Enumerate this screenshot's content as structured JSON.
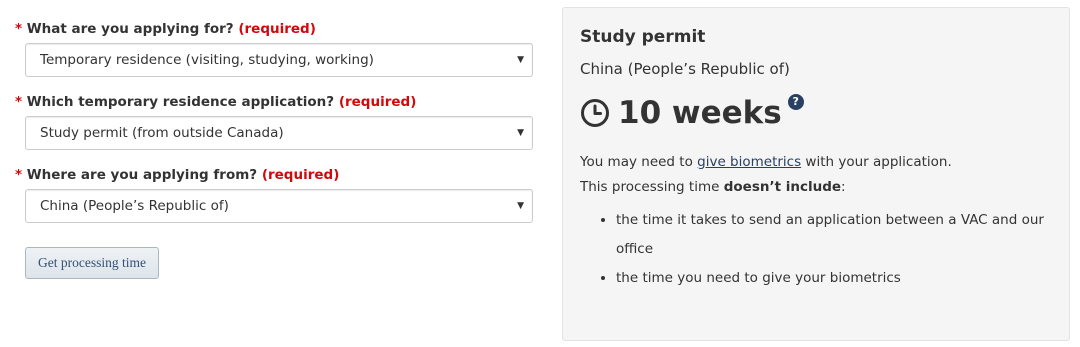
{
  "form": {
    "required_marker": "*",
    "required_text": "(required)",
    "fields": [
      {
        "label": "What are you applying for?",
        "value": "Temporary residence (visiting, studying, working)"
      },
      {
        "label": "Which temporary residence application?",
        "value": "Study permit (from outside Canada)"
      },
      {
        "label": "Where are you applying from?",
        "value": "China (People’s Republic of)"
      }
    ],
    "submit_label": "Get processing time"
  },
  "result": {
    "title": "Study permit",
    "country": "China (People’s Republic of)",
    "duration": "10 weeks",
    "help_icon_glyph": "?",
    "biometrics_before": "You may need to ",
    "biometrics_link": "give biometrics",
    "biometrics_after": " with your application.",
    "excludes_before": "This processing time ",
    "excludes_bold": "doesn’t include",
    "excludes_after": ":",
    "excluded_items": [
      "the time it takes to send an application between a VAC and our office",
      "the time you need to give your biometrics"
    ]
  },
  "icons": {
    "select_caret": "▼",
    "clock": "clock-icon",
    "help": "question-circle-icon"
  },
  "colors": {
    "required": "#d3080c",
    "link": "#284162",
    "panel_bg": "#f5f5f5",
    "button_text": "#335075"
  }
}
